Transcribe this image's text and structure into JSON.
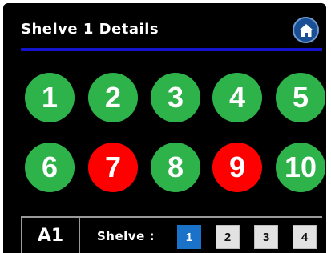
{
  "header": {
    "title": "Shelve 1 Details",
    "home_icon": "home-icon",
    "rule_color": "#1414cf"
  },
  "bins": [
    {
      "label": "1",
      "status": "ok"
    },
    {
      "label": "2",
      "status": "ok"
    },
    {
      "label": "3",
      "status": "ok"
    },
    {
      "label": "4",
      "status": "ok"
    },
    {
      "label": "5",
      "status": "ok"
    },
    {
      "label": "6",
      "status": "ok"
    },
    {
      "label": "7",
      "status": "error"
    },
    {
      "label": "8",
      "status": "ok"
    },
    {
      "label": "9",
      "status": "error"
    },
    {
      "label": "10",
      "status": "ok"
    }
  ],
  "status_colors": {
    "ok": "#2eb34b",
    "error": "#ff0000"
  },
  "footer": {
    "location": "A1",
    "shelve_label": "Shelve :",
    "shelves": [
      "1",
      "2",
      "3",
      "4"
    ],
    "selected_shelf": "1",
    "active_color": "#1a73c8"
  }
}
